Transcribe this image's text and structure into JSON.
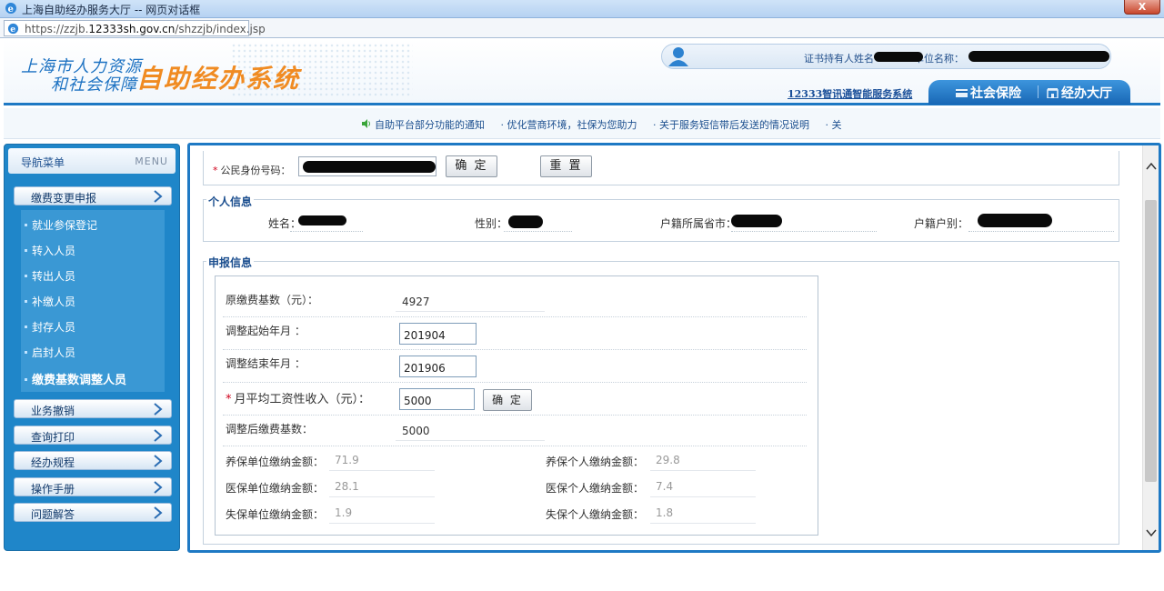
{
  "window": {
    "title": "上海自助经办服务大厅 -- 网页对话框",
    "close_label": "X",
    "url_prefix": "https://zzjb.",
    "url_domain": "12333sh.gov.cn",
    "url_path": "/shzzjb/index.jsp"
  },
  "header": {
    "logo_line1": "上海市人力资源",
    "logo_line2": "和社会保障",
    "logo_big": "自助经办系统",
    "holder_label": "证书持有人姓名",
    "unit_label": "单位名称：",
    "service_link": "12333智讯通智能服务系统",
    "tab_social": "社会保险",
    "tab_hall": "经办大厅"
  },
  "notice": {
    "items": [
      "自助平台部分功能的通知",
      "· 优化营商环境，社保为您助力",
      "· 关于服务短信带后发送的情况说明",
      "· 关"
    ]
  },
  "nav": {
    "title": "导航菜单",
    "menu": "MENU",
    "categories": [
      "缴费变更申报",
      "业务撤销",
      "查询打印",
      "经办规程",
      "操作手册",
      "问题解答"
    ],
    "items": [
      "就业参保登记",
      "转入人员",
      "转出人员",
      "补缴人员",
      "封存人员",
      "启封人员",
      "缴费基数调整人员"
    ]
  },
  "id_section": {
    "label": "公民身份号码：",
    "confirm": "确 定",
    "reset": "重 置"
  },
  "personal": {
    "legend": "个人信息",
    "name_label": "姓名：",
    "gender_label": "性别：",
    "province_label": "户籍所属省市：",
    "hukou_label": "户籍户别："
  },
  "application": {
    "legend": "申报信息",
    "orig_base_label": "原缴费基数（元）：",
    "orig_base_value": "4927",
    "start_label": "调整起始年月 ：",
    "start_value": "201904",
    "end_label": "调整结束年月 ：",
    "end_value": "201906",
    "income_label": "月平均工资性收入（元）：",
    "income_value": "5000",
    "income_confirm": "确 定",
    "adjusted_label": "调整后缴费基数：",
    "adjusted_value": "5000",
    "pension_unit_label": "养保单位缴纳金额：",
    "pension_unit_value": "71.9",
    "pension_person_label": "养保个人缴纳金额：",
    "pension_person_value": "29.8",
    "medical_unit_label": "医保单位缴纳金额：",
    "medical_unit_value": "28.1",
    "medical_person_label": "医保个人缴纳金额：",
    "medical_person_value": "7.4",
    "unemp_unit_label": "失保单位缴纳金额：",
    "unemp_unit_value": "1.9",
    "unemp_person_label": "失保个人缴纳金额：",
    "unemp_person_value": "1.8"
  }
}
